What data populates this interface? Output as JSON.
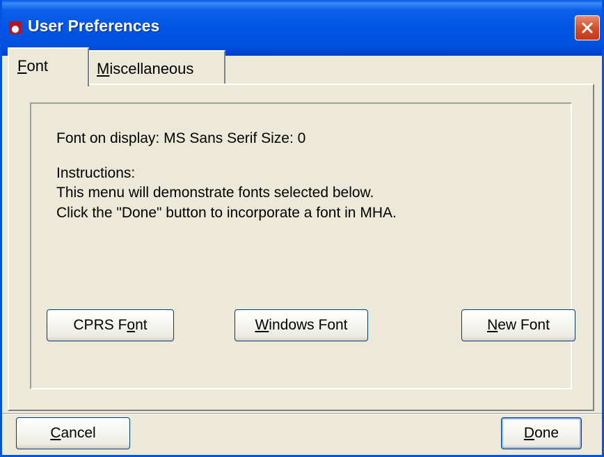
{
  "window": {
    "title": "User Preferences",
    "icon": "mha-app-icon",
    "close_label": "close-icon"
  },
  "tabs": [
    {
      "pre": "",
      "mnemonic": "F",
      "post": "ont",
      "selected": true
    },
    {
      "pre": "",
      "mnemonic": "M",
      "post": "iscellaneous",
      "selected": false
    }
  ],
  "font_tab": {
    "font_on_display": "Font on display: MS Sans Serif   Size: 0",
    "instructions_heading": "Instructions:",
    "instruction_line_1": "This menu will demonstrate fonts selected below.",
    "instruction_line_2": "Click the \"Done\" button to incorporate a font in MHA.",
    "buttons": {
      "cprs_font": {
        "pre": "CPRS F",
        "mnemonic": "o",
        "post": "nt"
      },
      "windows_font": {
        "pre": "",
        "mnemonic": "W",
        "post": "indows Font"
      },
      "new_font": {
        "pre": "",
        "mnemonic": "N",
        "post": "ew Font"
      }
    }
  },
  "footer": {
    "cancel": {
      "pre": "",
      "mnemonic": "C",
      "post": "ancel"
    },
    "done": {
      "pre": "",
      "mnemonic": "D",
      "post": "one"
    }
  },
  "colors": {
    "titlebar": "#0055e5",
    "face": "#ece9d8",
    "close_button": "#d2502c"
  }
}
